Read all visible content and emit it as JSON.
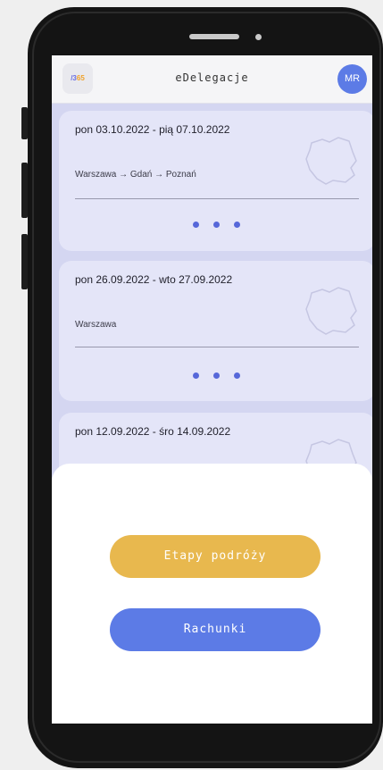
{
  "app": {
    "title": "eDelegacje",
    "logo_text_prefix": "/3",
    "logo_text_suffix": "65",
    "avatar_initials": "MR"
  },
  "trips": [
    {
      "dates": "pon 03.10.2022 - pią 07.10.2022",
      "route": "Warszawa → Gdań → Poznań"
    },
    {
      "dates": "pon 26.09.2022 - wto 27.09.2022",
      "route": "Warszawa"
    },
    {
      "dates": "pon 12.09.2022 - śro 14.09.2022",
      "route": ""
    }
  ],
  "sheet": {
    "primary_button": "Etapy podróży",
    "secondary_button": "Rachunki"
  },
  "colors": {
    "accent_blue": "#5c7be6",
    "accent_yellow": "#e8b84e",
    "card_bg": "#e4e5f8",
    "screen_bg": "#d4d6f1"
  }
}
